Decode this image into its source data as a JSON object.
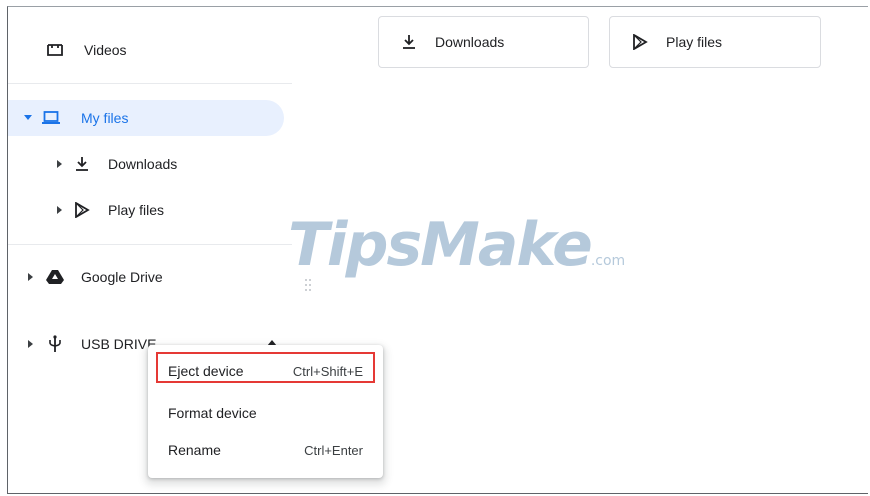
{
  "sidebar": {
    "videos": {
      "label": "Videos",
      "icon": "videos-icon"
    },
    "my_files": {
      "label": "My files",
      "icon": "laptop-icon"
    },
    "downloads": {
      "label": "Downloads",
      "icon": "download-icon"
    },
    "play_files": {
      "label": "Play files",
      "icon": "play-store-icon"
    },
    "google_drive": {
      "label": "Google Drive",
      "icon": "google-drive-icon"
    },
    "usb_drive": {
      "label": "USB DRIVE",
      "icon": "usb-icon"
    }
  },
  "tiles": [
    {
      "label": "Downloads",
      "icon": "download-icon"
    },
    {
      "label": "Play files",
      "icon": "play-store-icon"
    }
  ],
  "context_menu": {
    "items": [
      {
        "label": "Eject device",
        "shortcut": "Ctrl+Shift+E"
      },
      {
        "label": "Format device",
        "shortcut": ""
      },
      {
        "label": "Rename",
        "shortcut": "Ctrl+Enter"
      }
    ]
  },
  "watermark": {
    "text": "TipsMake",
    "suffix": ".com"
  },
  "colors": {
    "accent": "#1a73e8",
    "selected_bg": "#e8f0fe",
    "highlight_border": "#e53935"
  }
}
